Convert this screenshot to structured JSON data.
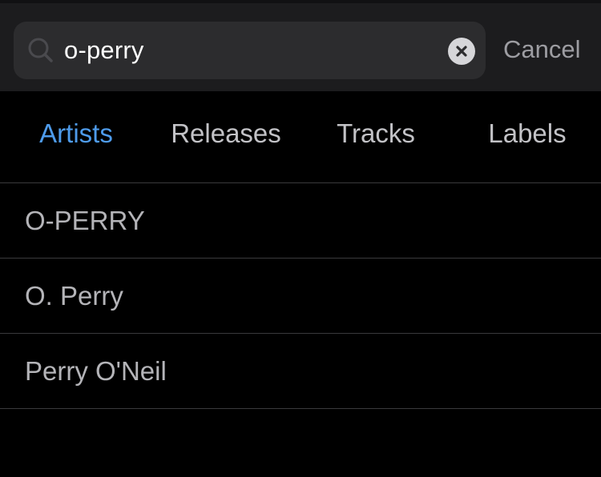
{
  "search": {
    "value": "o-perry",
    "cancel_label": "Cancel",
    "icon": "search-icon",
    "clear_icon": "clear-icon"
  },
  "tabs": [
    {
      "label": "Artists",
      "active": true
    },
    {
      "label": "Releases",
      "active": false
    },
    {
      "label": "Tracks",
      "active": false
    },
    {
      "label": "Labels",
      "active": false
    }
  ],
  "results": [
    {
      "name": "O-PERRY"
    },
    {
      "name": "O. Perry"
    },
    {
      "name": "Perry O'Neil"
    }
  ],
  "colors": {
    "background": "#000000",
    "top_bar": "#1c1c1e",
    "search_field": "#2c2c2e",
    "active_tab": "#4e9bea",
    "inactive_tab": "#c2c2c6",
    "result_text": "#b4b4b8"
  }
}
